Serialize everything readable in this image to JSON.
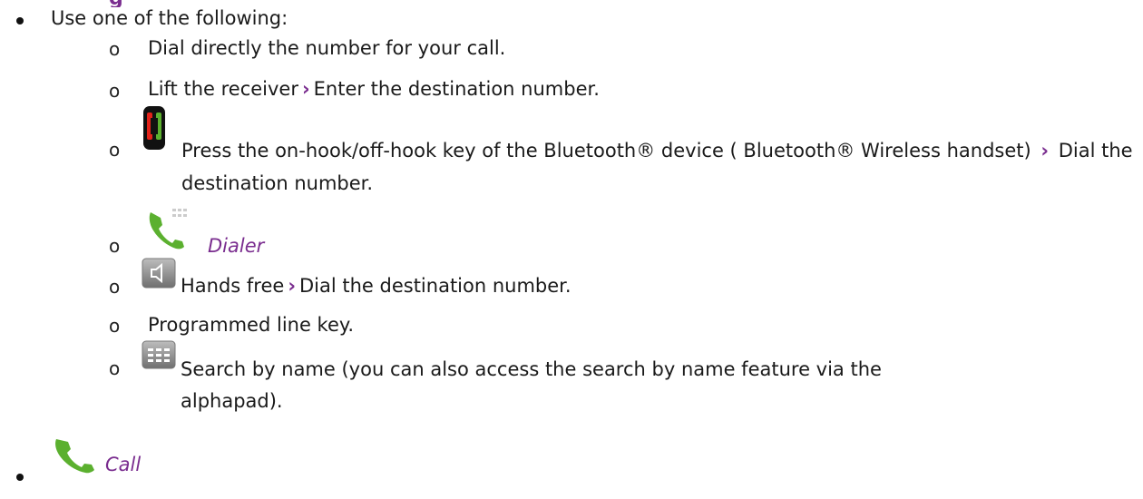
{
  "heading_fragment": "g",
  "intro": "Use one of the following:",
  "options": [
    {
      "text": "Dial directly the number for your call."
    },
    {
      "pre": "Lift the receiver",
      "post": "Enter the destination number."
    },
    {
      "pre": "Press the on-hook/off-hook key of the Bluetooth® device ( Bluetooth® Wireless handset)",
      "post": "Dial the destination number.",
      "icon": "bluetooth-handset-icon"
    },
    {
      "label": "Dialer",
      "icon": "dialer-phone-icon"
    },
    {
      "pre": "Hands free",
      "post": "Dial the destination number.",
      "icon": "speaker-key-icon"
    },
    {
      "text": "Programmed line key."
    },
    {
      "text": "Search by name (you can also access the search by name feature via the alphapad).",
      "icon": "dial-pad-key-icon"
    }
  ],
  "final": {
    "label": "Call",
    "icon": "call-phone-icon"
  },
  "separator": "›",
  "colors": {
    "accent": "#7a2d8f",
    "phone_green": "#5bb02f",
    "handset_red": "#e2231a"
  }
}
